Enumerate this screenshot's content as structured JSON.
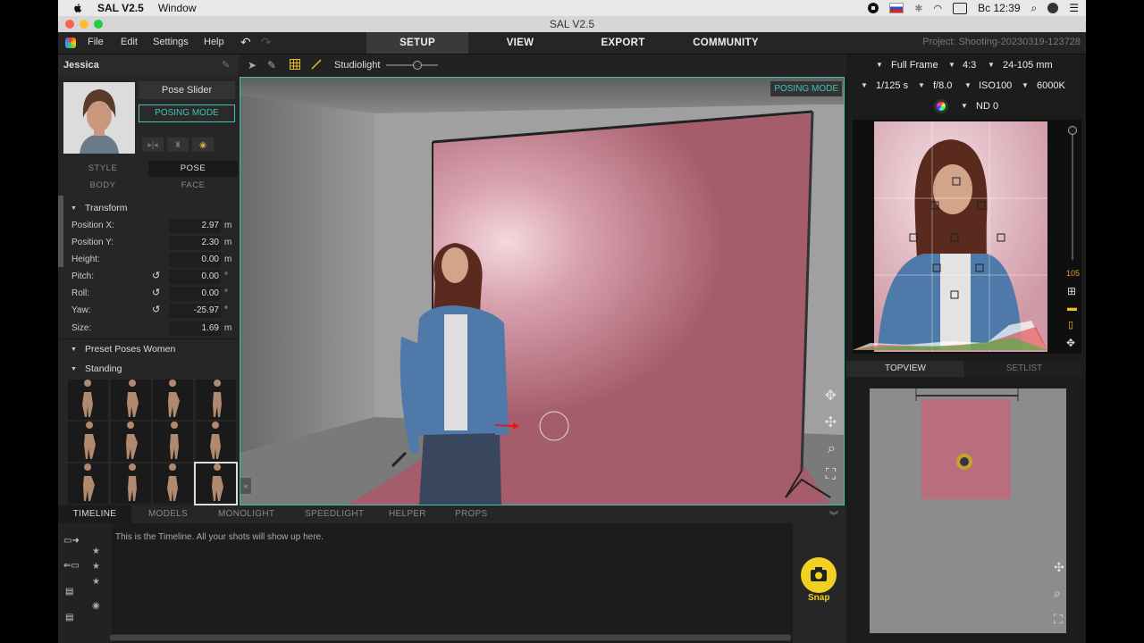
{
  "macos": {
    "app_name": "SAL V2.5",
    "menu_window": "Window",
    "clock": "Вс 12:39",
    "window_title": "SAL V2.5"
  },
  "menu": {
    "file": "File",
    "edit": "Edit",
    "settings": "Settings",
    "help": "Help"
  },
  "nav": {
    "tabs": [
      {
        "label": "SETUP",
        "active": true
      },
      {
        "label": "VIEW",
        "active": false
      },
      {
        "label": "EXPORT",
        "active": false
      },
      {
        "label": "COMMUNITY",
        "active": false
      }
    ],
    "project": "Project: Shooting-20230319-123728"
  },
  "left": {
    "model_name": "Jessica",
    "pose_slider": "Pose Slider",
    "posing_mode": "POSING MODE",
    "tabs": {
      "style": "STYLE",
      "pose": "POSE",
      "body": "BODY",
      "face": "FACE"
    },
    "transform_title": "Transform",
    "props": [
      {
        "label": "Position X:",
        "value": "2.97",
        "unit": "m"
      },
      {
        "label": "Position Y:",
        "value": "2.30",
        "unit": "m"
      },
      {
        "label": "Height:",
        "value": "0.00",
        "unit": "m"
      },
      {
        "label": "Pitch:",
        "value": "0.00",
        "unit": "°"
      },
      {
        "label": "Roll:",
        "value": "0.00",
        "unit": "°"
      },
      {
        "label": "Yaw:",
        "value": "-25.97",
        "unit": "°"
      },
      {
        "label": "Size:",
        "value": "1.69",
        "unit": "m"
      }
    ],
    "preset_title": "Preset Poses Women",
    "standing_title": "Standing"
  },
  "viewport_toolbar": {
    "studiolight": "Studiolight",
    "slider_fraction": 0.6
  },
  "viewport": {
    "badge": "POSING MODE"
  },
  "bottom": {
    "tabs": [
      "TIMELINE",
      "MODELS",
      "MONOLIGHT",
      "SPEEDLIGHT",
      "HELPER",
      "PROPS"
    ],
    "timeline_text": "This is the Timeline. All your shots will show up here.",
    "snap_label": "Snap"
  },
  "camera": {
    "sensor": "Full Frame",
    "ratio": "4:3",
    "lens": "24-105 mm",
    "shutter": "1/125 s",
    "aperture": "f/8.0",
    "iso": "ISO100",
    "wb": "6000K",
    "nd": "ND 0",
    "zoom_label": "105"
  },
  "right_tabs": {
    "topview": "TOPVIEW",
    "setlist": "SETLIST"
  },
  "colors": {
    "accent": "#3ec4b4",
    "backdrop": "#b86e7d",
    "snap": "#f0d020"
  }
}
